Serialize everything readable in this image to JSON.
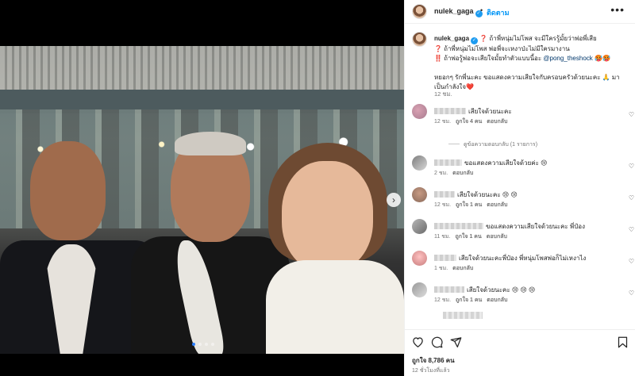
{
  "post": {
    "username": "nulek_gaga",
    "verified": true,
    "follow_label": "ติดตาม",
    "separator": "•",
    "more_label": "•••"
  },
  "caption": {
    "username": "nulek_gaga",
    "line1": "❓ ถ้าพี่หนุ่มไม่โพส จะมีใครรู้มั้ยว่าพ่อพี่เสีย",
    "line2": "❓ ถ้าพี่หนุ่มไม่โพส พ่อพี่จะเหงาป่ะไม่มีใครมางาน",
    "line3": "‼️ ถ้าพ่อรู้พ่อจะเสียใจมั้ยทำตัวแบบนี้อะ ",
    "mention": "@pong_theshock",
    "line3_end": " 🥵🥵",
    "line4": "หยอกๆ รักพี่นะคะ ขอแสดงความเสียใจกับครอบครัวด้วยนะคะ 🙏 มาเป็นกำลังใจ❤️",
    "time": "12 ชม."
  },
  "comments": [
    {
      "text": "เสียใจด้วยนะคะ",
      "time": "12 ชม.",
      "likes": "ถูกใจ 4 คน",
      "reply": "ตอบกลับ"
    },
    {
      "text": "ขอแสดงความเสียใจด้วยค่ะ 😢",
      "time": "2 ชม.",
      "likes": "",
      "reply": "ตอบกลับ"
    },
    {
      "text": "เสียใจด้วยนะคะ 😢 😢",
      "time": "12 ชม.",
      "likes": "ถูกใจ 1 คน",
      "reply": "ตอบกลับ"
    },
    {
      "text": "ขอแสดงความเสียใจด้วยนะคะ พี่ป๋อง",
      "time": "11 ชม.",
      "likes": "ถูกใจ 1 คน",
      "reply": "ตอบกลับ"
    },
    {
      "text": "เสียใจด้วยนะคะพี่ป๋อง พี่หนุ่มโพสพ่อก็ไม่เหงาไง",
      "time": "1 ชม.",
      "likes": "",
      "reply": "ตอบกลับ"
    },
    {
      "text": "เสียใจด้วยนะคะ 😢 😢 😢",
      "time": "12 ชม.",
      "likes": "ถูกใจ 1 คน",
      "reply": "ตอบกลับ"
    }
  ],
  "view_replies": "ดูข้อความตอบกลับ (1 รายการ)",
  "actions": {
    "like_icon": "heart-icon",
    "comment_icon": "comment-icon",
    "share_icon": "share-icon",
    "save_icon": "bookmark-icon"
  },
  "likes": "ถูกใจ 8,786 คน",
  "posted_ago": "12 ชั่วโมงที่แล้ว",
  "carousel": {
    "total": 4,
    "active": 1
  }
}
